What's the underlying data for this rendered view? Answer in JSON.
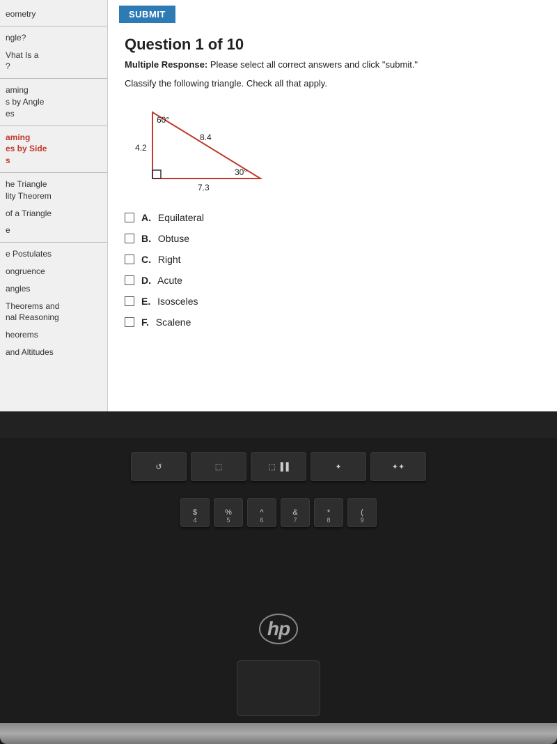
{
  "sidebar": {
    "items": [
      {
        "label": "eometry",
        "active": false
      },
      {
        "label": "ngle?",
        "active": false
      },
      {
        "label": "Vhat Is a",
        "active": false
      },
      {
        "label": "?",
        "active": false
      },
      {
        "label": "aming",
        "active": false
      },
      {
        "label": "s by Angle",
        "active": false
      },
      {
        "label": "es",
        "active": false
      },
      {
        "label": "aming",
        "active": false
      },
      {
        "label": "es by Side",
        "active": true
      },
      {
        "label": "s",
        "active": false
      },
      {
        "label": "he Triangle",
        "active": false
      },
      {
        "label": "lity Theorem",
        "active": false
      },
      {
        "label": "of a Triangle",
        "active": false
      },
      {
        "label": "e",
        "active": false
      },
      {
        "label": "e Postulates",
        "active": false
      },
      {
        "label": "ongruence",
        "active": false
      },
      {
        "label": "angles",
        "active": false
      },
      {
        "label": "Theorems and",
        "active": false
      },
      {
        "label": "nal Reasoning",
        "active": false
      },
      {
        "label": "heorems",
        "active": false
      },
      {
        "label": "and Altitudes",
        "active": false
      }
    ]
  },
  "submit_button": "SUBMIT",
  "question": {
    "title": "Question 1 of 10",
    "type_label": "Multiple Response:",
    "instruction": "Please select all correct answers and click \"submit.\"",
    "body": "Classify the following triangle. Check all that apply.",
    "triangle": {
      "angle_top": "60°",
      "angle_bottom_right": "30°",
      "side_left": "4.2",
      "side_hypotenuse": "8.4",
      "side_bottom": "7.3"
    },
    "choices": [
      {
        "letter": "A.",
        "text": "Equilateral"
      },
      {
        "letter": "B.",
        "text": "Obtuse"
      },
      {
        "letter": "C.",
        "text": "Right"
      },
      {
        "letter": "D.",
        "text": "Acute"
      },
      {
        "letter": "E.",
        "text": "Isosceles"
      },
      {
        "letter": "F.",
        "text": "Scalene"
      }
    ]
  },
  "keyboard": {
    "row1": [
      "↺",
      "⬚",
      "⬚▐▐",
      "✦",
      "✦"
    ],
    "row2": [
      "$",
      "%",
      "^",
      "&",
      "*",
      "("
    ],
    "row2_sub": [
      "4",
      "5",
      "6",
      "7",
      "8",
      "9"
    ]
  }
}
